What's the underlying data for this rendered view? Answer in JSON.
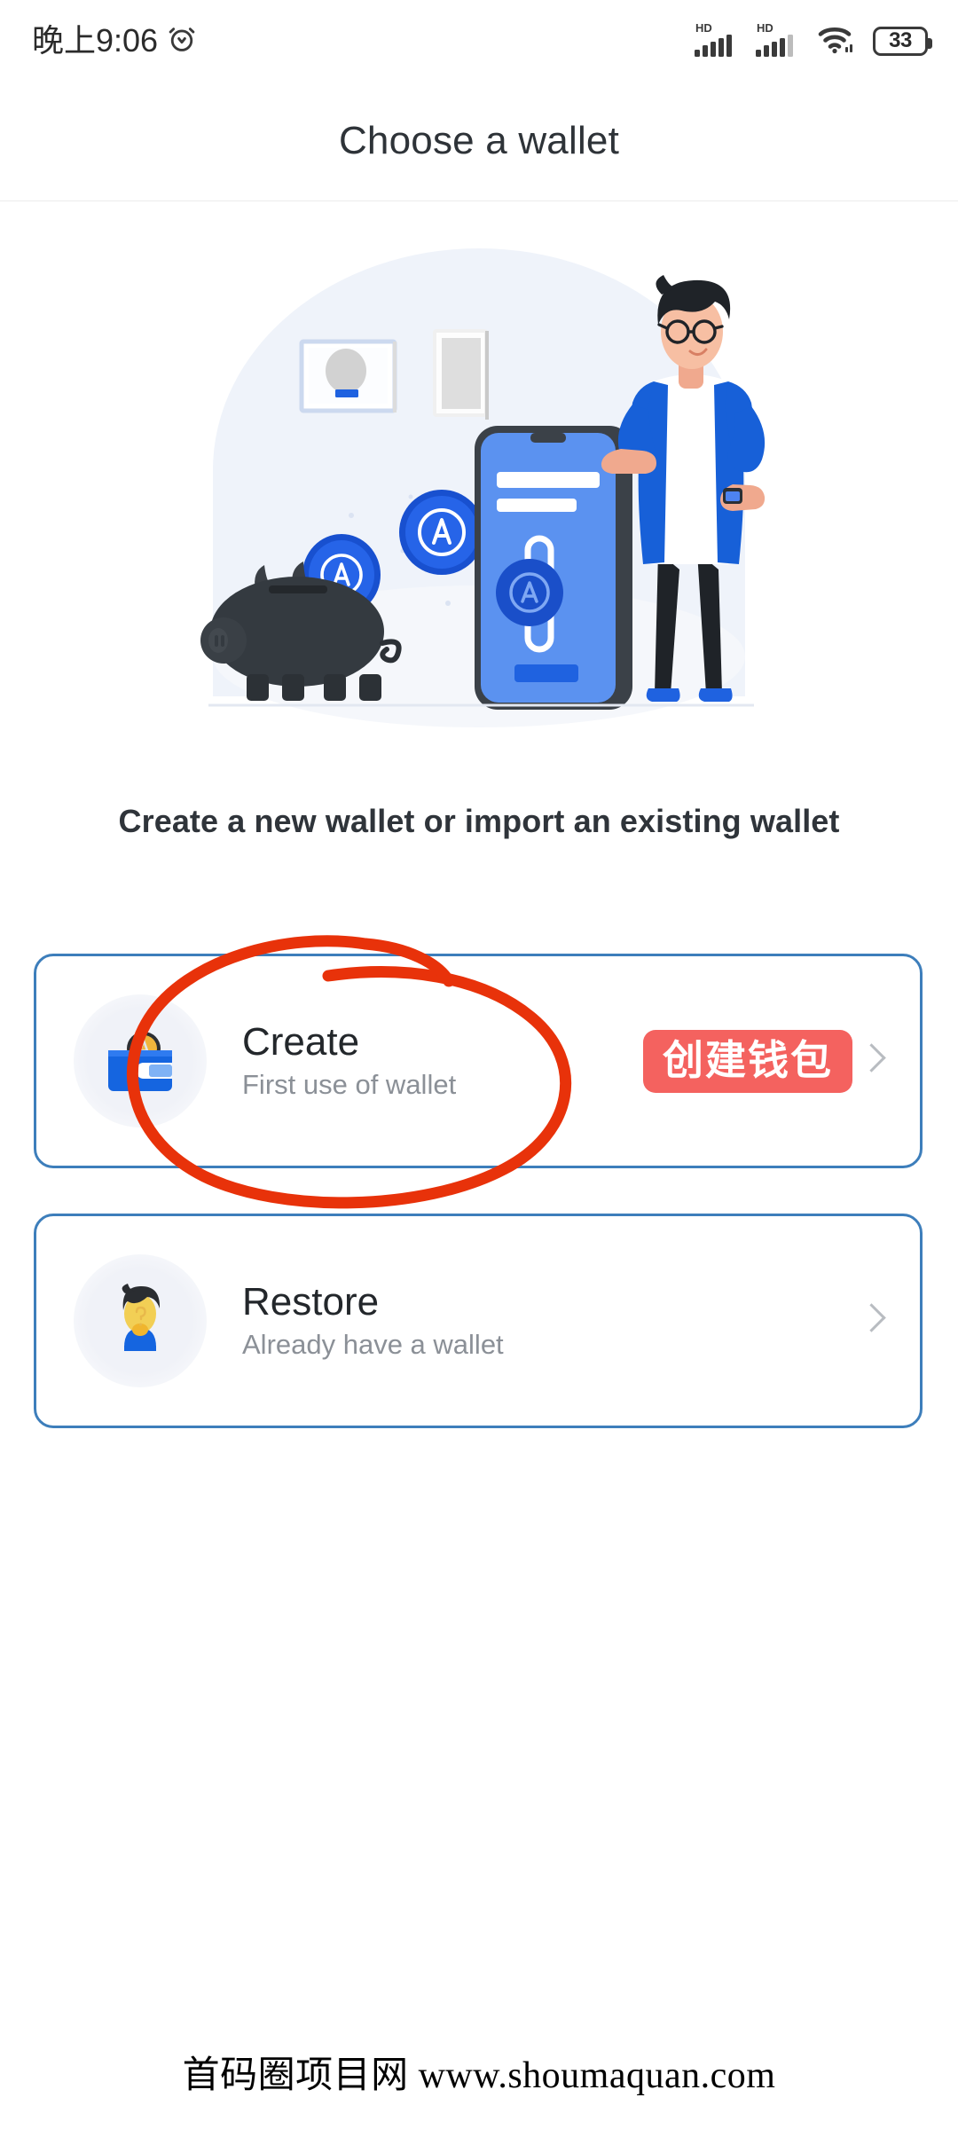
{
  "status_bar": {
    "time": "晚上9:06",
    "alarm_icon": "alarm-clock-icon",
    "signal_1_label": "HD",
    "signal_2_label": "HD",
    "wifi_icon": "wifi-icon",
    "battery_level": "33"
  },
  "header": {
    "title": "Choose a wallet"
  },
  "illustration": {
    "name": "wallet-onboarding-illustration",
    "alt": "Piggy bank with coins, smartphone and a man standing"
  },
  "main": {
    "subtitle": "Create a new wallet or import an existing wallet",
    "options": [
      {
        "id": "create",
        "icon": "wallet-icon",
        "title": "Create",
        "subtitle": "First use of wallet",
        "badge": "创建钱包",
        "chevron": "chevron-right-icon"
      },
      {
        "id": "restore",
        "icon": "user-avatar-icon",
        "title": "Restore",
        "subtitle": "Already have a wallet",
        "badge": "",
        "chevron": "chevron-right-icon"
      }
    ]
  },
  "annotation": {
    "name": "red-circle-highlight",
    "color": "#E8320A",
    "target": "create"
  },
  "footer": {
    "watermark": "首码圈项目网 www.shoumaquan.com"
  },
  "colors": {
    "card_border": "#3D7EBB",
    "badge_red": "#F4625F",
    "annotation_red": "#E8320A",
    "title_text": "#2E3338",
    "sub_text": "#8B9097",
    "coin_blue": "#1A5CE0"
  }
}
